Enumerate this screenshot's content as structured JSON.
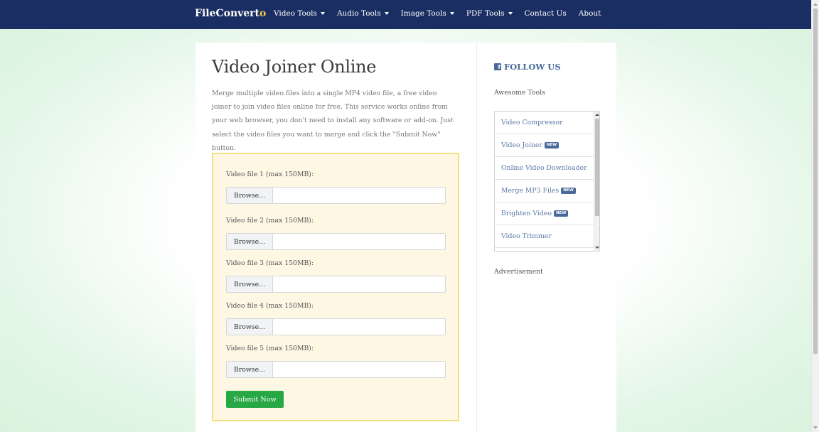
{
  "nav": {
    "brand_main": "FileConvert",
    "brand_accent": "o",
    "items": [
      {
        "label": "Video Tools"
      },
      {
        "label": "Audio Tools"
      },
      {
        "label": "Image Tools"
      },
      {
        "label": "PDF Tools"
      },
      {
        "label": "Contact Us"
      },
      {
        "label": "About"
      }
    ]
  },
  "main": {
    "title": "Video Joiner Online",
    "intro": "Merge multiple video files into a single MP4 video file, a free video joiner to join video files online for free. This service works online from your web browser, you don't need to install any software or add-on. Just select the video files you want to merge and click the \"Submit Now\" button.",
    "files": [
      {
        "label": "Video file 1 (max 150MB):",
        "browse": "Browse..."
      },
      {
        "label": "Video file 2 (max 150MB):",
        "browse": "Browse..."
      },
      {
        "label": "Video file 3 (max 150MB):",
        "browse": "Browse..."
      },
      {
        "label": "Video file 4 (max 150MB):",
        "browse": "Browse..."
      },
      {
        "label": "Video file 5 (max 150MB):",
        "browse": "Browse..."
      }
    ],
    "submit_label": "Submit Now"
  },
  "sidebar": {
    "follow_label": "FOLLOW US",
    "fb_glyph": "f",
    "tools_heading": "Awesome Tools",
    "tools": [
      {
        "label": "Video Compressor",
        "badge": ""
      },
      {
        "label": "Video Joiner",
        "badge": "NEW"
      },
      {
        "label": "Online Video Downloader",
        "badge": ""
      },
      {
        "label": "Merge MP3 Files",
        "badge": "NEW"
      },
      {
        "label": "Brighten Video",
        "badge": "NEW"
      },
      {
        "label": "Video Trimmer",
        "badge": ""
      }
    ],
    "ad_label": "Advertisement"
  },
  "colors": {
    "navbar": "#1b2e63",
    "brand_accent": "#f5c542",
    "submit": "#28a745",
    "upload_bg": "#fdf7e4",
    "upload_border": "#f3df7f",
    "link": "#5a7aa6"
  }
}
